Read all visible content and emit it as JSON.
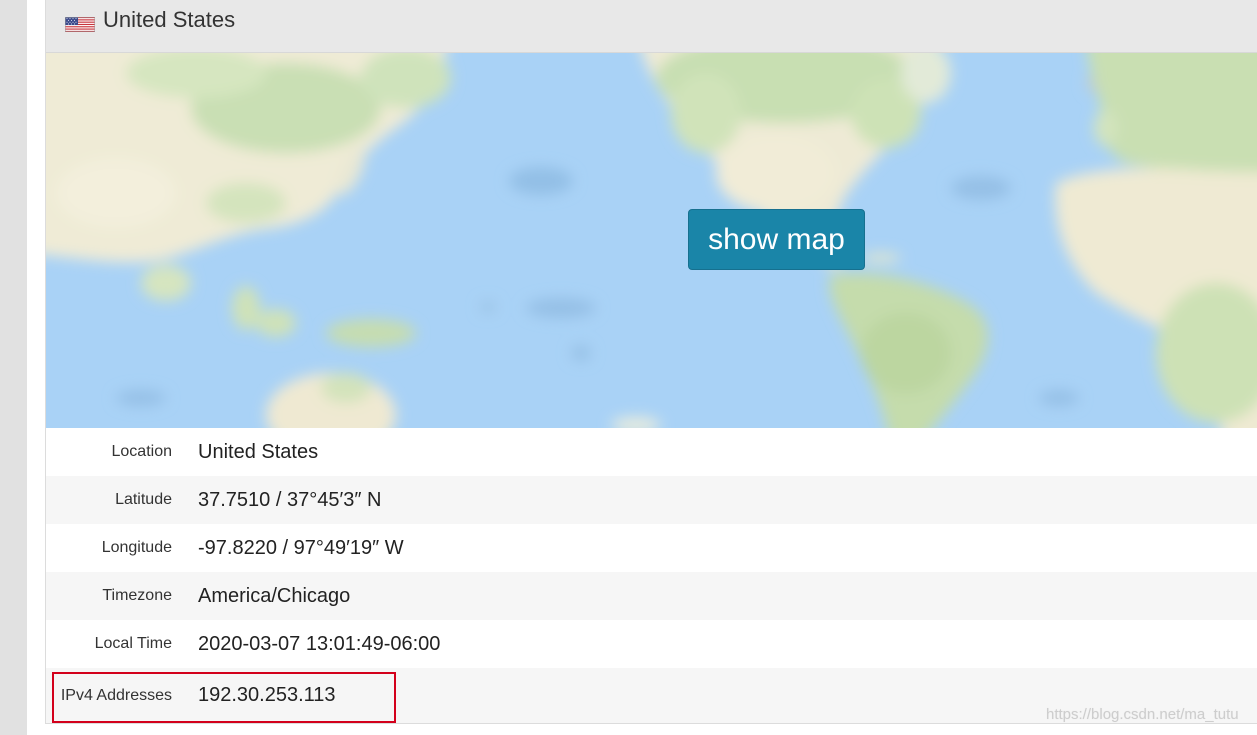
{
  "header": {
    "country": "United States",
    "flag_icon": "us-flag-icon"
  },
  "map": {
    "button_label": "show map"
  },
  "details": [
    {
      "label": "Location",
      "value": "United States"
    },
    {
      "label": "Latitude",
      "value": "37.7510 / 37°45′3″ N"
    },
    {
      "label": "Longitude",
      "value": "-97.8220 / 97°49′19″ W"
    },
    {
      "label": "Timezone",
      "value": "America/Chicago"
    },
    {
      "label": "Local Time",
      "value": "2020-03-07 13:01:49-06:00"
    },
    {
      "label": "IPv4 Addresses",
      "value": "192.30.253.113"
    }
  ],
  "watermark": "https://blog.csdn.net/ma_tutu",
  "colors": {
    "header_bg": "#e8e8e8",
    "button_bg": "#1a85a8",
    "highlight_border": "#d3001b",
    "ocean": "#a9d2f6",
    "row_alt_bg": "#f6f6f6"
  }
}
